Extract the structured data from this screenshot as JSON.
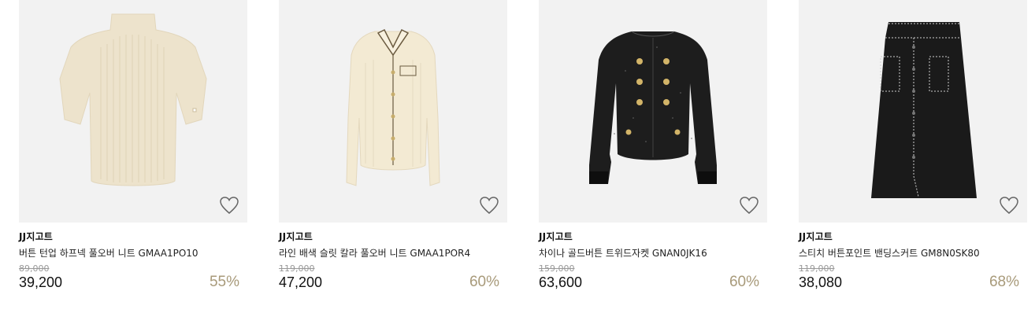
{
  "products": [
    {
      "brand": "JJ지고트",
      "name": "버튼 턴업 하프넥 풀오버 니트 GMAA1PO10",
      "original_price": "89,000",
      "price": "39,200",
      "discount": "55%",
      "image_icon": "ribbed-halfneck-knit-image",
      "colors": {
        "garment": "#ede3cc",
        "background": "#f2f2f2"
      }
    },
    {
      "brand": "JJ지고트",
      "name": "라인 배색 슬릿 칼라 풀오버 니트 GMAA1POR4",
      "original_price": "119,000",
      "price": "47,200",
      "discount": "60%",
      "image_icon": "collar-cardigan-knit-image",
      "colors": {
        "garment": "#f3ead3",
        "background": "#f2f2f2"
      }
    },
    {
      "brand": "JJ지고트",
      "name": "차이나 골드버튼 트위드자켓 GNAN0JK16",
      "original_price": "159,000",
      "price": "63,600",
      "discount": "60%",
      "image_icon": "tweed-jacket-image",
      "colors": {
        "garment": "#1d1d1d",
        "background": "#f2f2f2"
      }
    },
    {
      "brand": "JJ지고트",
      "name": "스티치 버튼포인트 밴딩스커트 GM8N0SK80",
      "original_price": "119,000",
      "price": "38,080",
      "discount": "68%",
      "image_icon": "stitch-skirt-image",
      "colors": {
        "garment": "#1a1a1a",
        "background": "#f2f2f2"
      }
    }
  ],
  "colors": {
    "discount": "#a89a7a",
    "strike_price": "#999999"
  }
}
